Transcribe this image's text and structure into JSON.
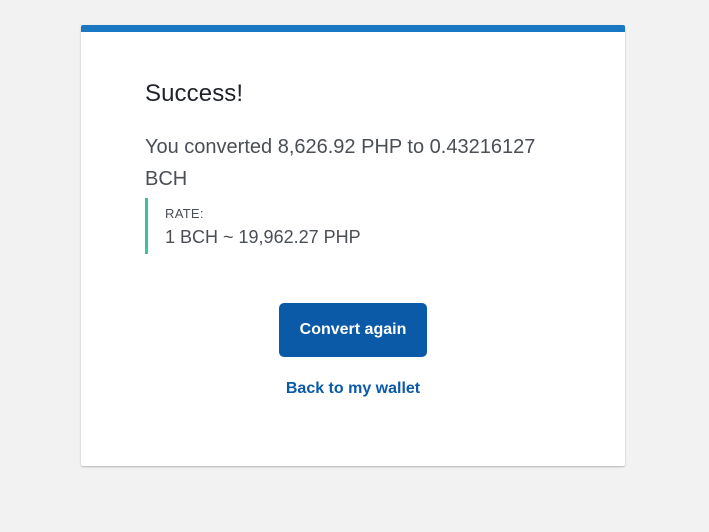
{
  "card": {
    "accent_color": "#1a78c2",
    "rate_accent_color": "#3dbfa6"
  },
  "success": {
    "title": "Success!",
    "message": "You converted 8,626.92 PHP to 0.43216127 BCH",
    "rate_label": "RATE:",
    "rate_value": "1 BCH ~ 19,962.27 PHP"
  },
  "actions": {
    "convert_again_label": "Convert again",
    "back_to_wallet_label": "Back to my wallet"
  }
}
